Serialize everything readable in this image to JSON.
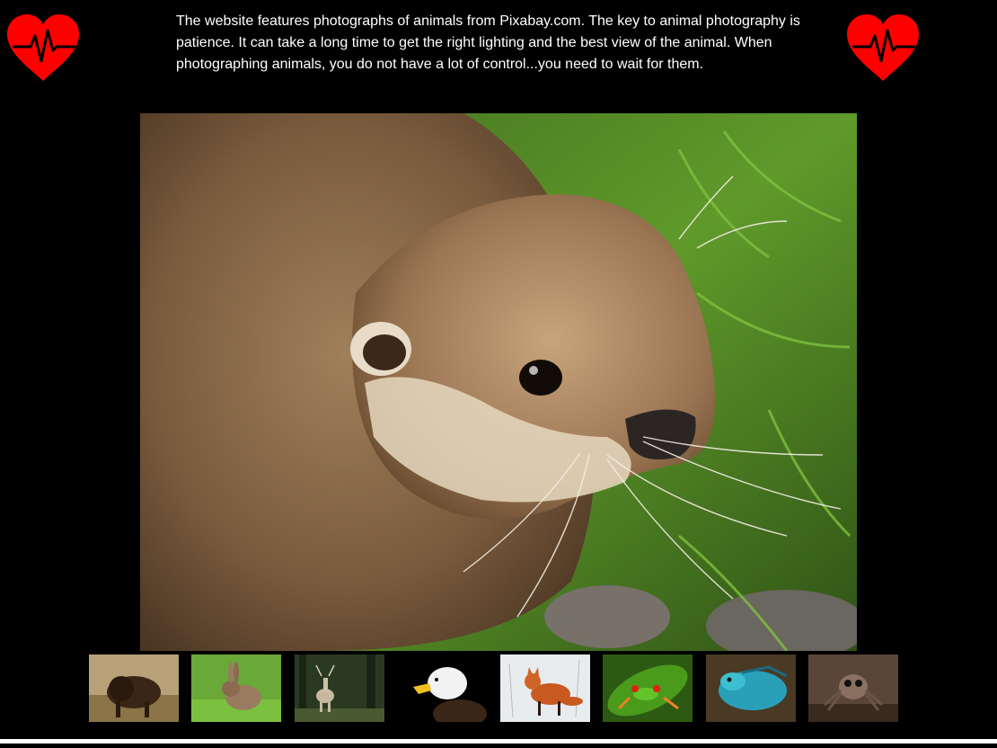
{
  "intro": {
    "text": "The website features photographs of animals from Pixabay.com. The key to animal photography is patience. It can take a long time to get the right lighting and the best view of the animal. When photographing animals, you do not have a lot of control...you need to wait for them."
  },
  "icons": {
    "left": "heartbeat-icon",
    "right": "heartbeat-icon",
    "color": "#ff0000"
  },
  "main_photo": {
    "subject": "otter"
  },
  "thumbnails": [
    {
      "subject": "bison"
    },
    {
      "subject": "rabbit"
    },
    {
      "subject": "deer"
    },
    {
      "subject": "bald eagle"
    },
    {
      "subject": "fox"
    },
    {
      "subject": "tree frog"
    },
    {
      "subject": "lizard"
    },
    {
      "subject": "jumping spider"
    }
  ]
}
